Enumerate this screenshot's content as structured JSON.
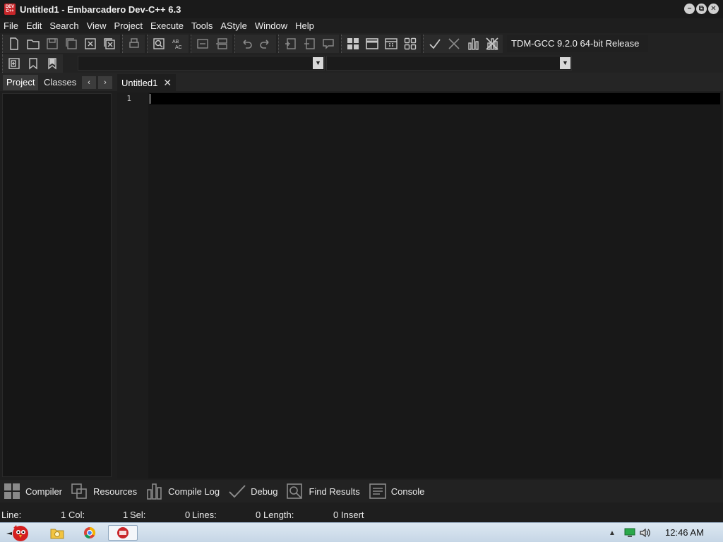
{
  "window": {
    "title": "Untitled1 - Embarcadero Dev-C++ 6.3",
    "app_icon_text": "DEV\nC++",
    "minimize": "−",
    "restore": "⧉",
    "close": "✕"
  },
  "menu": [
    "File",
    "Edit",
    "Search",
    "View",
    "Project",
    "Execute",
    "Tools",
    "AStyle",
    "Window",
    "Help"
  ],
  "toolbar": {
    "compiler": "TDM-GCC 9.2.0 64-bit Release"
  },
  "left_panel": {
    "tabs": [
      "Project",
      "Classes"
    ],
    "prev": "‹",
    "next": "›"
  },
  "editor": {
    "tab_label": "Untitled1",
    "tab_close": "✕",
    "line_number": "1"
  },
  "bottom_tabs": [
    "Compiler",
    "Resources",
    "Compile Log",
    "Debug",
    "Find Results",
    "Console"
  ],
  "status": {
    "line_label": "Line:",
    "line_value": "1",
    "col_label": "Col:",
    "col_value": "1",
    "sel_label": "Sel:",
    "sel_value": "0",
    "lines_label": "Lines:",
    "lines_value": "0",
    "length_label": "Length:",
    "length_value": "0",
    "mode": "Insert"
  },
  "taskbar": {
    "clock": "12:46 AM",
    "tray_arrow": "▲"
  },
  "colors": {
    "background": "#1e1e1e",
    "editor": "#181818",
    "current_line": "#000000",
    "accent": "#c8262a"
  }
}
